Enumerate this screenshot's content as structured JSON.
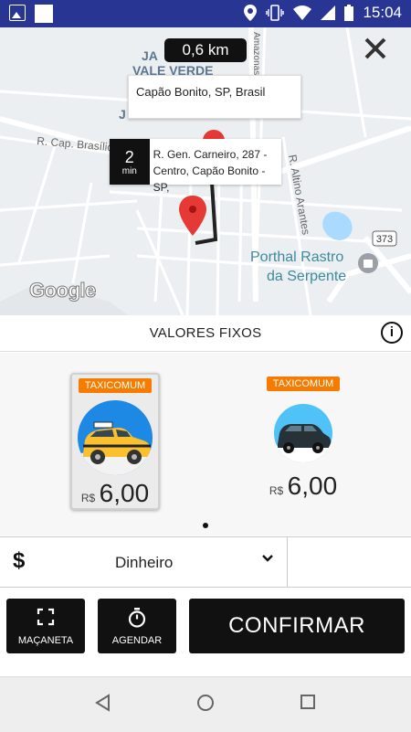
{
  "status_bar": {
    "time": "15:04"
  },
  "map": {
    "distance": "0,6 km",
    "destination_address": "Capão Bonito, SP, Brasil",
    "eta_value": "2",
    "eta_unit": "min",
    "origin_address_line1": "R. Gen. Carneiro, 287 -",
    "origin_address_line2": "Centro, Capão Bonito - SP,",
    "labels": {
      "vale_verde": "VALE VERDE",
      "street_cap": "R. Cap. Brasílio",
      "street_altino": "R. Altino Arantes",
      "street_amazonas": "Amazonas",
      "poi_line1": "Porthal Rastro",
      "poi_line2": "da Serpente",
      "route_shield": "373",
      "google": "Google"
    }
  },
  "section_title": "VALORES FIXOS",
  "options": [
    {
      "badge": "TAXICOMUM",
      "currency": "R$",
      "price": "6,00",
      "selected": true
    },
    {
      "badge": "TAXICOMUM",
      "currency": "R$",
      "price": "6,00",
      "selected": false
    }
  ],
  "payment": {
    "method": "Dinheiro"
  },
  "buttons": {
    "macaneta": "MAÇANETA",
    "agendar": "AGENDAR",
    "confirmar": "CONFIRMAR"
  },
  "colors": {
    "status_bar": "#283593",
    "badge": "#f57c00",
    "button_dark": "#111111",
    "pin": "#e53935"
  },
  "icons": {
    "close": "close-icon",
    "info": "info-icon",
    "payment": "dollar-icon",
    "chevron": "chevron-down-icon",
    "macaneta": "frame-corners-icon",
    "agendar": "timer-icon"
  }
}
